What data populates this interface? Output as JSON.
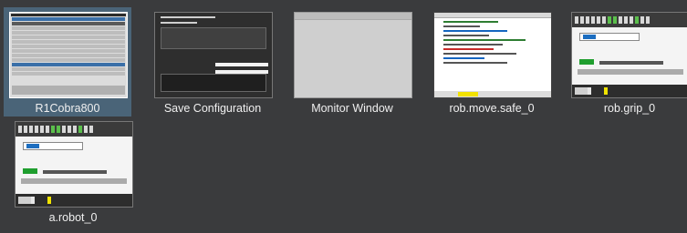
{
  "windows": [
    {
      "label": "R1Cobra800",
      "selected": true
    },
    {
      "label": "Save Configuration"
    },
    {
      "label": "Monitor Window"
    },
    {
      "label": "rob.move.safe_0"
    },
    {
      "label": "rob.grip_0"
    },
    {
      "label": "a.robot_0"
    }
  ]
}
